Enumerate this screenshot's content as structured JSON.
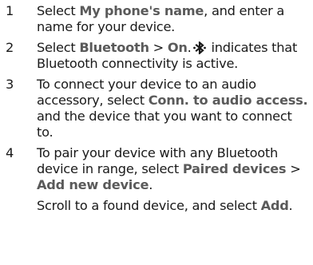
{
  "steps": [
    {
      "num": "1",
      "t1": "Select ",
      "b1": "My phone's name",
      "t2": ", and enter a name for your device."
    },
    {
      "num": "2",
      "t1": "Select ",
      "b1": "Bluetooth",
      "t2": " > ",
      "b2": "On",
      "t3": ".",
      "icon": "bluetooth-icon",
      "t4": " indicates that Bluetooth connectivity is active."
    },
    {
      "num": "3",
      "t1": "To connect your device to an audio accessory, select ",
      "b1": "Conn. to audio access.",
      "t2": " and the device that you want to connect to."
    },
    {
      "num": "4",
      "t1": "To pair your device with any Bluetooth device in range, select ",
      "b1": "Paired devices",
      "t2": " > ",
      "b2": "Add new device",
      "t3": ".",
      "s1": "Scroll to a found device, and select ",
      "sb1": "Add",
      "s2": "."
    }
  ]
}
